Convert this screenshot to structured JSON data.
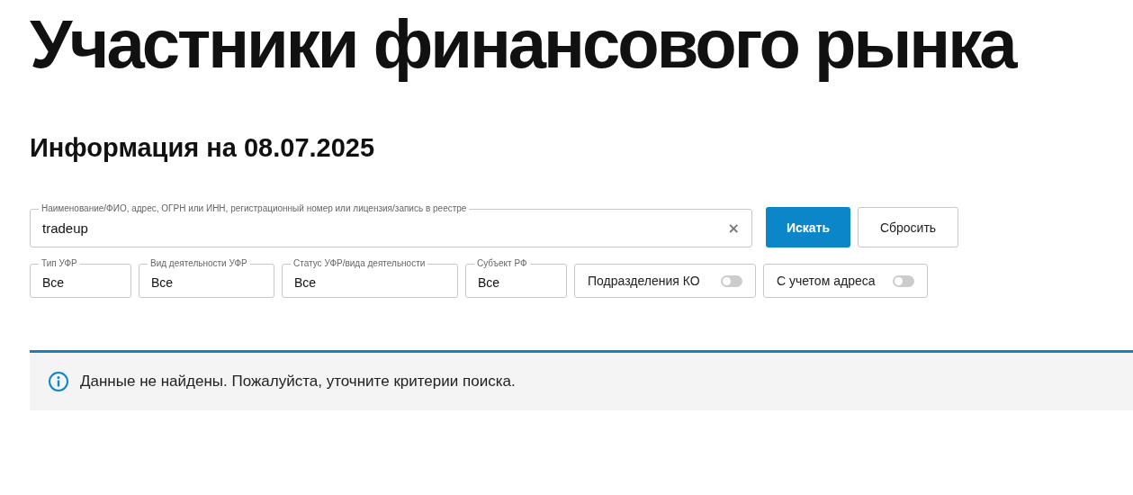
{
  "title": "Участники финансового рынка",
  "subtitle": "Информация на 08.07.2025",
  "search": {
    "label": "Наименование/ФИО, адрес, ОГРН или ИНН, регистрационный номер или лицензия/запись в реестре",
    "value": "tradeup",
    "clear": "×"
  },
  "buttons": [
    {
      "label": "Искать",
      "kind": "primary"
    },
    {
      "label": "Сбросить",
      "kind": "secondary"
    }
  ],
  "filters": [
    {
      "kind": "select",
      "label": "Тип УФР",
      "value": "Все"
    },
    {
      "kind": "select",
      "label": "Вид деятельности УФР",
      "value": "Все"
    },
    {
      "kind": "select",
      "label": "Статус УФР/вида деятельности",
      "value": "Все"
    },
    {
      "kind": "select",
      "label": "Субъект РФ",
      "value": "Все"
    },
    {
      "kind": "toggle",
      "label": "Подразделения КО",
      "on": false
    },
    {
      "kind": "toggle",
      "label": "С учетом адреса",
      "on": false
    }
  ],
  "notice": {
    "text": "Данные не найдены. Пожалуйста, уточните критерии поиска."
  }
}
